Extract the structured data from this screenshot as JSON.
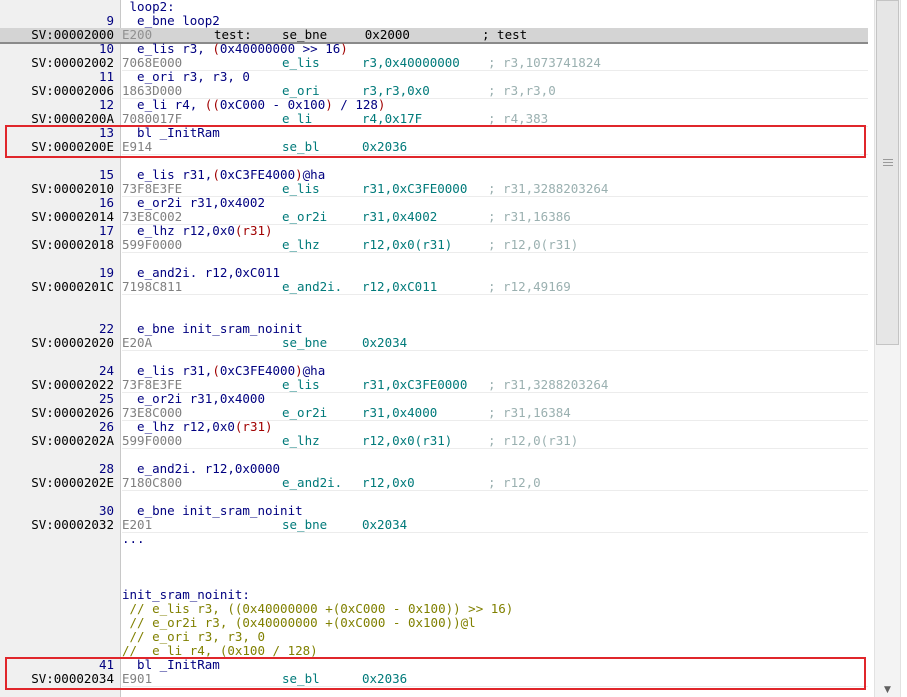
{
  "lines": [
    {
      "gutter": "",
      "label": " loop2:",
      "kind": "label"
    },
    {
      "gutter": "9",
      "kind": "src",
      "parts": [
        {
          "t": "  e_bne loop2",
          "s": "src"
        }
      ]
    },
    {
      "gutter": "SV:00002000",
      "kind": "hl",
      "hex": "E200",
      "mn": "test:",
      "op": "se_bne     0x2000",
      "an": "; test"
    },
    {
      "gutter": "10",
      "kind": "src",
      "parts": [
        {
          "t": "  e_lis r3, ",
          "s": "src"
        },
        {
          "t": "(",
          "s": "n"
        },
        {
          "t": "0x40000000 >> 16",
          "s": "src"
        },
        {
          "t": ")",
          "s": "n"
        }
      ]
    },
    {
      "gutter": "SV:00002002",
      "kind": "dis",
      "hex": "7068E000",
      "mn": "e_lis",
      "op": "r3,0x40000000",
      "an": "; r3,1073741824"
    },
    {
      "gutter": "11",
      "kind": "src",
      "parts": [
        {
          "t": "  e_ori r3, r3, 0",
          "s": "src"
        }
      ]
    },
    {
      "gutter": "SV:00002006",
      "kind": "dis",
      "hex": "1863D000",
      "mn": "e_ori",
      "op": "r3,r3,0x0",
      "an": "; r3,r3,0"
    },
    {
      "gutter": "12",
      "kind": "src",
      "parts": [
        {
          "t": "  e_li r4, ",
          "s": "src"
        },
        {
          "t": "((",
          "s": "n"
        },
        {
          "t": "0xC000 - 0x100",
          "s": "src"
        },
        {
          "t": ")",
          "s": "n"
        },
        {
          "t": " / 128",
          "s": "src"
        },
        {
          "t": ")",
          "s": "n"
        }
      ]
    },
    {
      "gutter": "SV:0000200A",
      "kind": "dis",
      "hex": "7080017F",
      "mn": "e_li",
      "op": "r4,0x17F",
      "an": "; r4,383"
    },
    {
      "gutter": "13",
      "kind": "src",
      "parts": [
        {
          "t": "  bl _InitRam",
          "s": "src"
        }
      ]
    },
    {
      "gutter": "SV:0000200E",
      "kind": "dis",
      "hex": "E914",
      "mn": "se_bl",
      "op": "0x2036",
      "an": ""
    },
    {
      "gutter": "",
      "kind": "blank"
    },
    {
      "gutter": "15",
      "kind": "src",
      "parts": [
        {
          "t": "  e_lis r31,",
          "s": "src"
        },
        {
          "t": "(",
          "s": "n"
        },
        {
          "t": "0xC3FE4000",
          "s": "src"
        },
        {
          "t": ")",
          "s": "n"
        },
        {
          "t": "@ha",
          "s": "src"
        }
      ]
    },
    {
      "gutter": "SV:00002010",
      "kind": "dis",
      "hex": "73F8E3FE",
      "mn": "e_lis",
      "op": "r31,0xC3FE0000",
      "an": "; r31,3288203264"
    },
    {
      "gutter": "16",
      "kind": "src",
      "parts": [
        {
          "t": "  e_or2i r31,0x4002",
          "s": "src"
        }
      ]
    },
    {
      "gutter": "SV:00002014",
      "kind": "dis",
      "hex": "73E8C002",
      "mn": "e_or2i",
      "op": "r31,0x4002",
      "an": "; r31,16386"
    },
    {
      "gutter": "17",
      "kind": "src",
      "parts": [
        {
          "t": "  e_lhz r12,0x0",
          "s": "src"
        },
        {
          "t": "(r31)",
          "s": "n"
        }
      ]
    },
    {
      "gutter": "SV:00002018",
      "kind": "dis",
      "hex": "599F0000",
      "mn": "e_lhz",
      "op": "r12,0x0(r31)",
      "an": "; r12,0(r31)"
    },
    {
      "gutter": "",
      "kind": "blank"
    },
    {
      "gutter": "19",
      "kind": "src",
      "parts": [
        {
          "t": "  e_and2i. r12,0xC011",
          "s": "src"
        }
      ]
    },
    {
      "gutter": "SV:0000201C",
      "kind": "dis",
      "hex": "7198C811",
      "mn": "e_and2i.",
      "op": "r12,0xC011",
      "an": "; r12,49169"
    },
    {
      "gutter": "",
      "kind": "blank"
    },
    {
      "gutter": "",
      "kind": "blank"
    },
    {
      "gutter": "22",
      "kind": "src",
      "parts": [
        {
          "t": "  e_bne init_sram_noinit",
          "s": "src"
        }
      ]
    },
    {
      "gutter": "SV:00002020",
      "kind": "dis",
      "hex": "E20A",
      "mn": "se_bne",
      "op": "0x2034",
      "an": ""
    },
    {
      "gutter": "",
      "kind": "blank"
    },
    {
      "gutter": "24",
      "kind": "src",
      "parts": [
        {
          "t": "  e_lis r31,",
          "s": "src"
        },
        {
          "t": "(",
          "s": "n"
        },
        {
          "t": "0xC3FE4000",
          "s": "src"
        },
        {
          "t": ")",
          "s": "n"
        },
        {
          "t": "@ha",
          "s": "src"
        }
      ]
    },
    {
      "gutter": "SV:00002022",
      "kind": "dis",
      "hex": "73F8E3FE",
      "mn": "e_lis",
      "op": "r31,0xC3FE0000",
      "an": "; r31,3288203264"
    },
    {
      "gutter": "25",
      "kind": "src",
      "parts": [
        {
          "t": "  e_or2i r31,0x4000",
          "s": "src"
        }
      ]
    },
    {
      "gutter": "SV:00002026",
      "kind": "dis",
      "hex": "73E8C000",
      "mn": "e_or2i",
      "op": "r31,0x4000",
      "an": "; r31,16384"
    },
    {
      "gutter": "26",
      "kind": "src",
      "parts": [
        {
          "t": "  e_lhz r12,0x0",
          "s": "src"
        },
        {
          "t": "(r31)",
          "s": "n"
        }
      ]
    },
    {
      "gutter": "SV:0000202A",
      "kind": "dis",
      "hex": "599F0000",
      "mn": "e_lhz",
      "op": "r12,0x0(r31)",
      "an": "; r12,0(r31)"
    },
    {
      "gutter": "",
      "kind": "blank"
    },
    {
      "gutter": "28",
      "kind": "src",
      "parts": [
        {
          "t": "  e_and2i. r12,0x0000",
          "s": "src"
        }
      ]
    },
    {
      "gutter": "SV:0000202E",
      "kind": "dis",
      "hex": "7180C800",
      "mn": "e_and2i.",
      "op": "r12,0x0",
      "an": "; r12,0"
    },
    {
      "gutter": "",
      "kind": "blank"
    },
    {
      "gutter": "30",
      "kind": "src",
      "parts": [
        {
          "t": "  e_bne init_sram_noinit",
          "s": "src"
        }
      ]
    },
    {
      "gutter": "SV:00002032",
      "kind": "dis",
      "hex": "E201",
      "mn": "se_bne",
      "op": "0x2034",
      "an": ""
    },
    {
      "gutter": "",
      "kind": "src",
      "parts": [
        {
          "t": "...",
          "s": "src"
        }
      ]
    },
    {
      "gutter": "",
      "kind": "blank"
    },
    {
      "gutter": "",
      "kind": "blank"
    },
    {
      "gutter": "",
      "kind": "blank"
    },
    {
      "gutter": "",
      "kind": "src",
      "parts": [
        {
          "t": "init_sram_noinit:",
          "s": "src"
        }
      ]
    },
    {
      "gutter": "",
      "kind": "src",
      "parts": [
        {
          "t": " // e_lis r3, ((0x40000000 +(0xC000 - 0x100)) >> 16)",
          "s": "cmt"
        }
      ]
    },
    {
      "gutter": "",
      "kind": "src",
      "parts": [
        {
          "t": " // e_or2i r3, (0x40000000 +(0xC000 - 0x100))@l",
          "s": "cmt"
        }
      ]
    },
    {
      "gutter": "",
      "kind": "src",
      "parts": [
        {
          "t": " // e_ori r3, r3, 0",
          "s": "cmt"
        }
      ]
    },
    {
      "gutter": "",
      "kind": "src",
      "parts": [
        {
          "t": "//  e_li r4, (0x100 / 128)",
          "s": "cmt"
        }
      ]
    },
    {
      "gutter": "41",
      "kind": "src",
      "parts": [
        {
          "t": "  bl _InitRam",
          "s": "src"
        }
      ]
    },
    {
      "gutter": "SV:00002034",
      "kind": "dis",
      "hex": "E901",
      "mn": "se_bl",
      "op": "0x2036",
      "an": ""
    }
  ],
  "highlights": {
    "box1_rows": [
      9,
      10
    ],
    "box2_rows": [
      47,
      48
    ],
    "color": "#e0262b"
  },
  "scrollbar": {
    "grip_icon": "scroll-grip-icon",
    "down_icon": "scroll-down-arrow-icon",
    "down_glyph": "▼",
    "thumb_fraction": 0.5
  }
}
